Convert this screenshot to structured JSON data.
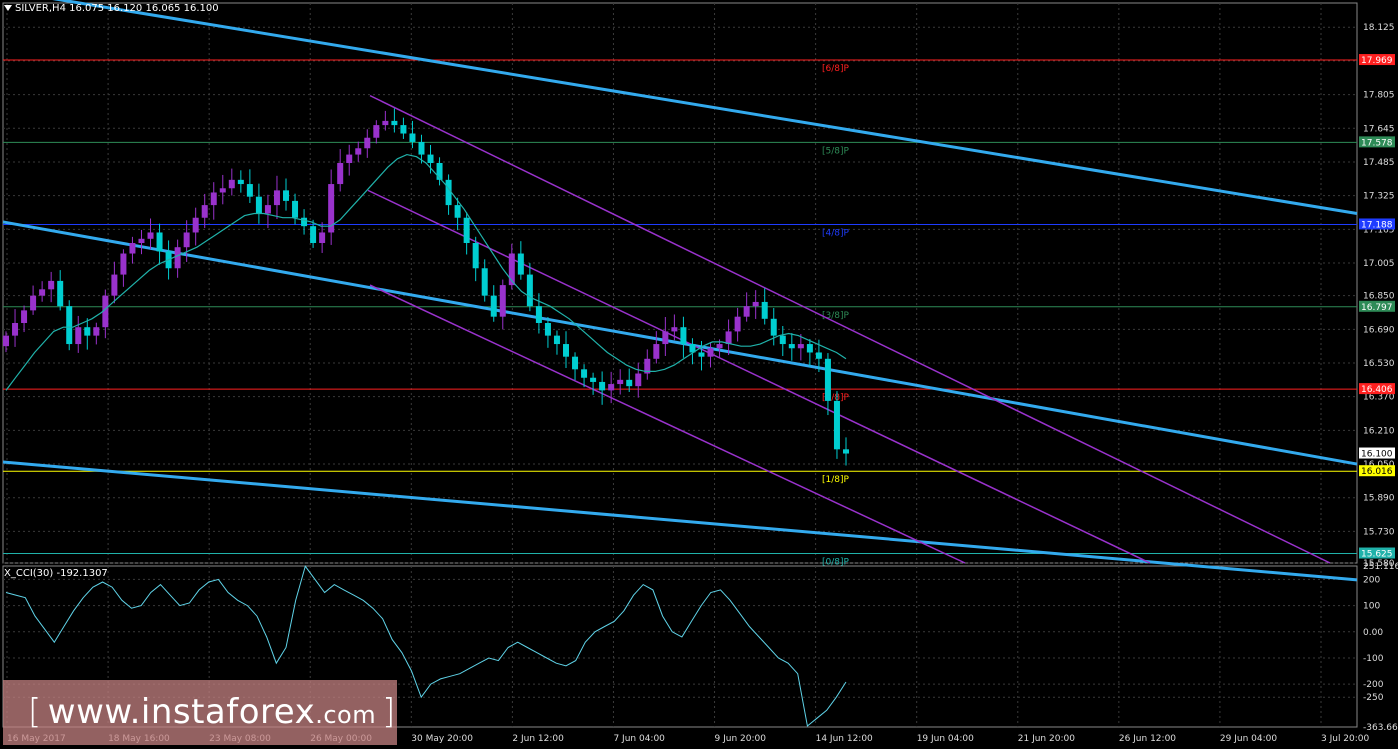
{
  "header": {
    "symbol_line": "SILVER,H4  16.075 16.120 16.065 16.100"
  },
  "indicator": {
    "label": "X_CCI(30) -192.1307"
  },
  "watermark": {
    "bracket_left": "[",
    "text_main": "www.instaforex",
    "text_small": ".com",
    "bracket_right": "]"
  },
  "colors": {
    "background": "#000000",
    "grid": "#3a3a3a",
    "bull_candle": "#9932cc",
    "bear_candle": "#00ced1",
    "ma_line": "#20b2aa",
    "trend_line": "#33aaee",
    "channel_line": "#9932cc",
    "cci_line": "#5fd3e8"
  },
  "chart_data": [
    {
      "type": "candlestick",
      "symbol": "SILVER",
      "timeframe": "H4",
      "ohlc_last": {
        "open": 16.075,
        "high": 16.12,
        "low": 16.065,
        "close": 16.1
      },
      "y_range": [
        15.58,
        18.24
      ],
      "y_ticks": [
        "18.125",
        "17.965",
        "17.805",
        "17.645",
        "17.485",
        "17.325",
        "17.165",
        "17.005",
        "16.850",
        "16.690",
        "16.530",
        "16.370",
        "16.210",
        "16.050",
        "15.890",
        "15.730",
        "15.580"
      ],
      "x_ticks": [
        "16 May 2017",
        "18 May 16:00",
        "23 May 08:00",
        "26 May 00:00",
        "30 May 20:00",
        "2 Jun 12:00",
        "7 Jun 04:00",
        "9 Jun 20:00",
        "14 Jun 12:00",
        "19 Jun 04:00",
        "21 Jun 20:00",
        "26 Jun 12:00",
        "29 Jun 04:00",
        "3 Jul 20:00"
      ],
      "close_path": [
        16.66,
        16.72,
        16.78,
        16.85,
        16.88,
        16.92,
        16.8,
        16.62,
        16.7,
        16.66,
        16.7,
        16.85,
        16.95,
        17.05,
        17.1,
        17.12,
        17.15,
        17.06,
        16.98,
        17.08,
        17.15,
        17.22,
        17.28,
        17.34,
        17.36,
        17.4,
        17.38,
        17.32,
        17.24,
        17.28,
        17.35,
        17.3,
        17.22,
        17.18,
        17.1,
        17.15,
        17.38,
        17.48,
        17.52,
        17.55,
        17.6,
        17.66,
        17.68,
        17.66,
        17.62,
        17.58,
        17.52,
        17.48,
        17.4,
        17.28,
        17.22,
        17.1,
        16.98,
        16.85,
        16.75,
        16.9,
        17.05,
        16.95,
        16.8,
        16.72,
        16.66,
        16.62,
        16.56,
        16.5,
        16.46,
        16.44,
        16.4,
        16.43,
        16.45,
        16.42,
        16.48,
        16.55,
        16.62,
        16.68,
        16.7,
        16.62,
        16.58,
        16.56,
        16.6,
        16.62,
        16.68,
        16.75,
        16.8,
        16.82,
        16.74,
        16.66,
        16.62,
        16.6,
        16.62,
        16.58,
        16.55,
        16.35,
        16.12,
        16.1
      ],
      "series": [
        {
          "name": "MA",
          "values": [
            16.4,
            16.46,
            16.52,
            16.58,
            16.63,
            16.68,
            16.7,
            16.7,
            16.72,
            16.74,
            16.77,
            16.81,
            16.85,
            16.89,
            16.93,
            16.97,
            17.0,
            17.02,
            17.04,
            17.06,
            17.08,
            17.11,
            17.14,
            17.17,
            17.2,
            17.23,
            17.24,
            17.24,
            17.23,
            17.22,
            17.22,
            17.21,
            17.2,
            17.18,
            17.18,
            17.21,
            17.26,
            17.31,
            17.36,
            17.41,
            17.46,
            17.5,
            17.52,
            17.51,
            17.48,
            17.43,
            17.38,
            17.32,
            17.26,
            17.19,
            17.12,
            17.05,
            16.98,
            16.92,
            16.87,
            16.84,
            16.82,
            16.8,
            16.77,
            16.74,
            16.7,
            16.66,
            16.62,
            16.58,
            16.55,
            16.52,
            16.5,
            16.49,
            16.49,
            16.5,
            16.52,
            16.55,
            16.58,
            16.61,
            16.63,
            16.63,
            16.62,
            16.61,
            16.61,
            16.62,
            16.64,
            16.66,
            16.67,
            16.66,
            16.64,
            16.62,
            16.6,
            16.58,
            16.55
          ]
        }
      ],
      "murrey_levels": [
        {
          "label": "[6/8]P",
          "value": 17.969,
          "price_label": "17.969",
          "color": "#ff2020"
        },
        {
          "label": "[5/8]P",
          "value": 17.578,
          "price_label": "17.578",
          "color": "#2e8b57"
        },
        {
          "label": "[4/8]P",
          "value": 17.188,
          "price_label": "17.188",
          "color": "#1e3cff"
        },
        {
          "label": "[3/8]P",
          "value": 16.797,
          "price_label": "16.797",
          "color": "#2e8b57"
        },
        {
          "label": "[2/8]P",
          "value": 16.406,
          "price_label": "16.406",
          "color": "#ff2020"
        },
        {
          "label": "[1/8]P",
          "value": 16.016,
          "price_label": "16.016",
          "color": "#ffff00"
        },
        {
          "label": "[0/8]P",
          "value": 15.625,
          "price_label": "15.625",
          "color": "#20b2aa"
        }
      ],
      "current_price": {
        "value": 16.1,
        "label": "16.100"
      },
      "grid": true
    },
    {
      "type": "line",
      "name": "X_CCI(30)",
      "value_last": -192.1307,
      "y_range": [
        -363.663,
        251.1164
      ],
      "y_ticks": [
        "251.1164",
        "200",
        "100",
        "0.00",
        "-100",
        "-200",
        "-250",
        "-363.663"
      ],
      "values": [
        150,
        140,
        130,
        60,
        10,
        -40,
        20,
        80,
        130,
        170,
        190,
        170,
        120,
        90,
        100,
        150,
        180,
        140,
        100,
        110,
        160,
        190,
        200,
        150,
        120,
        100,
        60,
        -20,
        -120,
        -60,
        120,
        250,
        200,
        150,
        180,
        160,
        140,
        120,
        90,
        50,
        -30,
        -80,
        -150,
        -250,
        -200,
        -180,
        -170,
        -160,
        -140,
        -120,
        -100,
        -110,
        -60,
        -40,
        -60,
        -80,
        -100,
        -120,
        -130,
        -110,
        -40,
        0,
        20,
        40,
        80,
        140,
        180,
        160,
        60,
        0,
        -20,
        40,
        100,
        150,
        160,
        120,
        70,
        20,
        -20,
        -60,
        -100,
        -120,
        -160,
        -360,
        -330,
        -300,
        -250,
        -192
      ]
    }
  ]
}
